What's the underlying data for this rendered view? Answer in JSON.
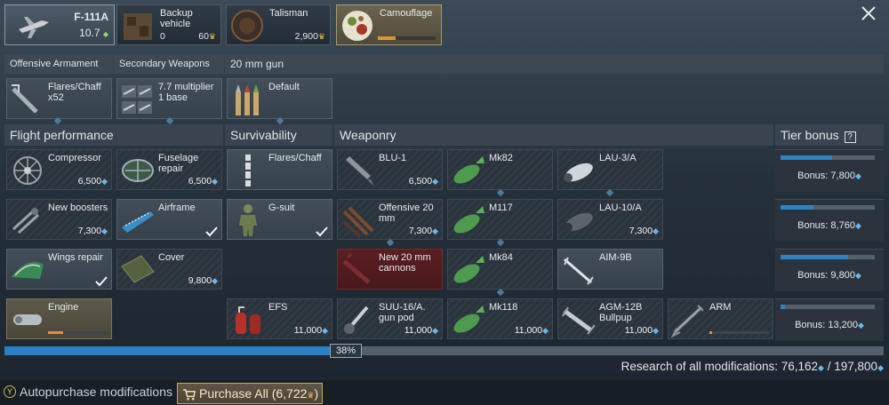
{
  "vehicle": {
    "name": "F-111A",
    "br": "10.7",
    "rank_mark": "◆"
  },
  "top_cards": {
    "backup": {
      "title": "Backup vehicle",
      "count": "0",
      "cost": "60"
    },
    "talisman": {
      "title": "Talisman",
      "cost": "2,900"
    },
    "camouflage": {
      "title": "Camouflage",
      "progress": 0.3
    }
  },
  "headers": {
    "offensive_armament": "Offensive Armament",
    "secondary_weapons": "Secondary Weapons",
    "gun": "20 mm gun",
    "flight_performance": "Flight performance",
    "survivability": "Survivability",
    "weaponry": "Weaponry",
    "tier_bonus": "Tier bonus",
    "help": "?"
  },
  "armament": {
    "flares": {
      "name": "Flares/Chaff",
      "sub": "x52"
    },
    "secondary": {
      "name": "7.7 multiplier",
      "sub": "1 base"
    },
    "gun_default": {
      "name": "Default"
    }
  },
  "modules": {
    "compressor": {
      "name": "Compressor",
      "cost": "6,500"
    },
    "fuselage_repair": {
      "name": "Fuselage repair",
      "cost": "6,500"
    },
    "new_boosters": {
      "name": "New boosters",
      "cost": "7,300"
    },
    "airframe": {
      "name": "Airframe"
    },
    "wings_repair": {
      "name": "Wings repair"
    },
    "cover": {
      "name": "Cover",
      "cost": "9,800"
    },
    "engine": {
      "name": "Engine",
      "progress": 0.25
    },
    "flares_chaff": {
      "name": "Flares/Chaff"
    },
    "g_suit": {
      "name": "G-suit"
    },
    "efs": {
      "name": "EFS",
      "cost": "11,000"
    },
    "blu1": {
      "name": "BLU-1",
      "cost": "6,500"
    },
    "mk82": {
      "name": "Mk82"
    },
    "lau3a": {
      "name": "LAU-3/A"
    },
    "offensive20": {
      "name": "Offensive 20 mm",
      "cost": "7,300"
    },
    "m117": {
      "name": "M117"
    },
    "lau10a": {
      "name": "LAU-10/A",
      "cost": "7,300"
    },
    "new20": {
      "name": "New 20 mm cannons"
    },
    "mk84": {
      "name": "Mk84"
    },
    "aim9b": {
      "name": "AIM-9B"
    },
    "suu16": {
      "name": "SUU-16/A. gun pod",
      "cost": "11,000"
    },
    "mk118": {
      "name": "Mk118",
      "cost": "11,000"
    },
    "agm12b": {
      "name": "AGM-12B Bullpup",
      "cost": "11,000"
    },
    "arm": {
      "name": "ARM",
      "progress": 0.05
    }
  },
  "tier_bonus": [
    {
      "label": "Bonus: 7,800",
      "progress": 0.55
    },
    {
      "label": "Bonus: 8,760",
      "progress": 0.35
    },
    {
      "label": "Bonus: 9,800",
      "progress": 0.72
    },
    {
      "label": "Bonus: 13,200",
      "progress": 0.05
    }
  ],
  "progress": {
    "percent_label": "38%",
    "value": 0.38
  },
  "research": {
    "label": "Research of all modifications: 76,162",
    "sep": "/",
    "total": "197,800"
  },
  "footer": {
    "y_button": "Y",
    "autopurchase": "Autopurchase modifications",
    "purchase_all": "Purchase All (6,722",
    "purchase_close": ")"
  },
  "icons": {
    "bolt": "◆",
    "crown": "♛",
    "close": "close-icon"
  },
  "colors": {
    "accent_blue": "#2a7fc4",
    "gold": "#e9b94a",
    "locked_red": "#5b1f22"
  }
}
